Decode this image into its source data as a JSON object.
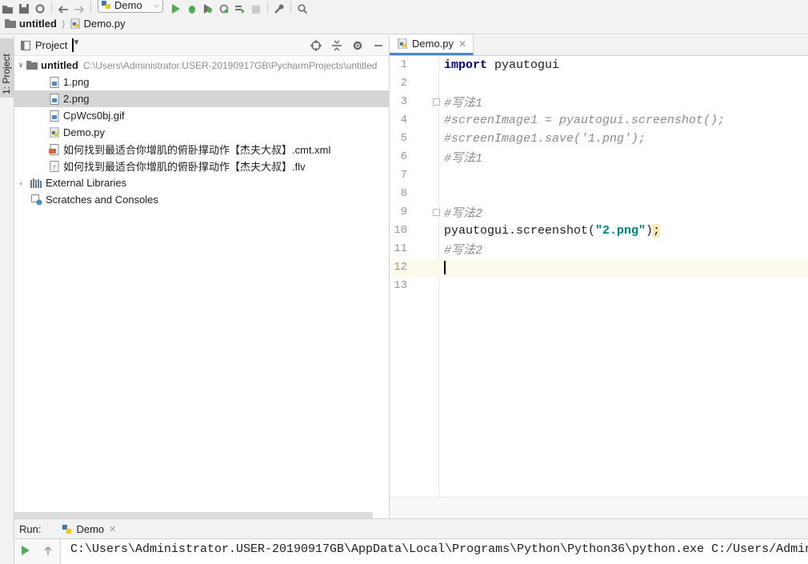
{
  "toolbar": {
    "run_config_label": "Demo",
    "icons": [
      "open-folder-icon",
      "save-icon",
      "sync-icon",
      "back-arrow-icon",
      "forward-arrow-icon",
      "run-icon",
      "debug-icon",
      "coverage-icon",
      "profile-icon",
      "build-icon",
      "stop-icon",
      "wrench-icon",
      "search-icon"
    ]
  },
  "breadcrumb": {
    "project": "untitled",
    "file": "Demo.py"
  },
  "left_strip": {
    "tab_label": "1: Project"
  },
  "project_panel": {
    "title": "Project",
    "tree": [
      {
        "label": "untitled",
        "path": "C:\\Users\\Administrator.USER-20190917GB\\PycharmProjects\\untitled",
        "type": "folder",
        "expanded": true
      },
      {
        "label": "1.png",
        "type": "image"
      },
      {
        "label": "2.png",
        "type": "image",
        "selected": true
      },
      {
        "label": "CpWcs0bj.gif",
        "type": "image"
      },
      {
        "label": "Demo.py",
        "type": "python"
      },
      {
        "label": "如何找到最适合你增肌的俯卧撑动作【杰夫大叔】.cmt.xml",
        "type": "xml"
      },
      {
        "label": "如何找到最适合你增肌的俯卧撑动作【杰夫大叔】.flv",
        "type": "unknown"
      },
      {
        "label": "External Libraries",
        "type": "libraries",
        "expanded": false
      },
      {
        "label": "Scratches and Consoles",
        "type": "scratches"
      }
    ]
  },
  "editor": {
    "tab_label": "Demo.py",
    "current_line": 12,
    "lines": [
      {
        "n": "1",
        "segments": [
          {
            "t": "import",
            "c": "kw"
          },
          {
            "t": " pyautogui",
            "c": ""
          }
        ]
      },
      {
        "n": "2",
        "segments": []
      },
      {
        "n": "3",
        "segments": [
          {
            "t": "#写法1",
            "c": "cmt"
          }
        ]
      },
      {
        "n": "4",
        "segments": [
          {
            "t": "#screenImage1 = pyautogui.screenshot();",
            "c": "cmt"
          }
        ]
      },
      {
        "n": "5",
        "segments": [
          {
            "t": "#screenImage1.save('1.png');",
            "c": "cmt"
          }
        ]
      },
      {
        "n": "6",
        "segments": [
          {
            "t": "#写法1",
            "c": "cmt"
          }
        ]
      },
      {
        "n": "7",
        "segments": []
      },
      {
        "n": "8",
        "segments": []
      },
      {
        "n": "9",
        "segments": [
          {
            "t": "#写法2",
            "c": "cmt"
          }
        ]
      },
      {
        "n": "10",
        "segments": [
          {
            "t": "pyautogui.screenshot(",
            "c": ""
          },
          {
            "t": "\"2.png\"",
            "c": "str"
          },
          {
            "t": ")",
            "c": ""
          },
          {
            "t": ";",
            "c": "semi"
          }
        ]
      },
      {
        "n": "11",
        "segments": [
          {
            "t": "#写法2",
            "c": "cmt"
          }
        ]
      },
      {
        "n": "12",
        "segments": []
      },
      {
        "n": "13",
        "segments": []
      }
    ]
  },
  "run_panel": {
    "label": "Run:",
    "tab_label": "Demo",
    "console_text": "C:\\Users\\Administrator.USER-20190917GB\\AppData\\Local\\Programs\\Python\\Python36\\python.exe C:/Users/Admin"
  },
  "colors": {
    "keyword": "#000080",
    "comment": "#8c8c8c",
    "string": "#008080",
    "selection": "#d5d5d5",
    "current_line": "#fcfaed",
    "run_green": "#4caf50"
  }
}
